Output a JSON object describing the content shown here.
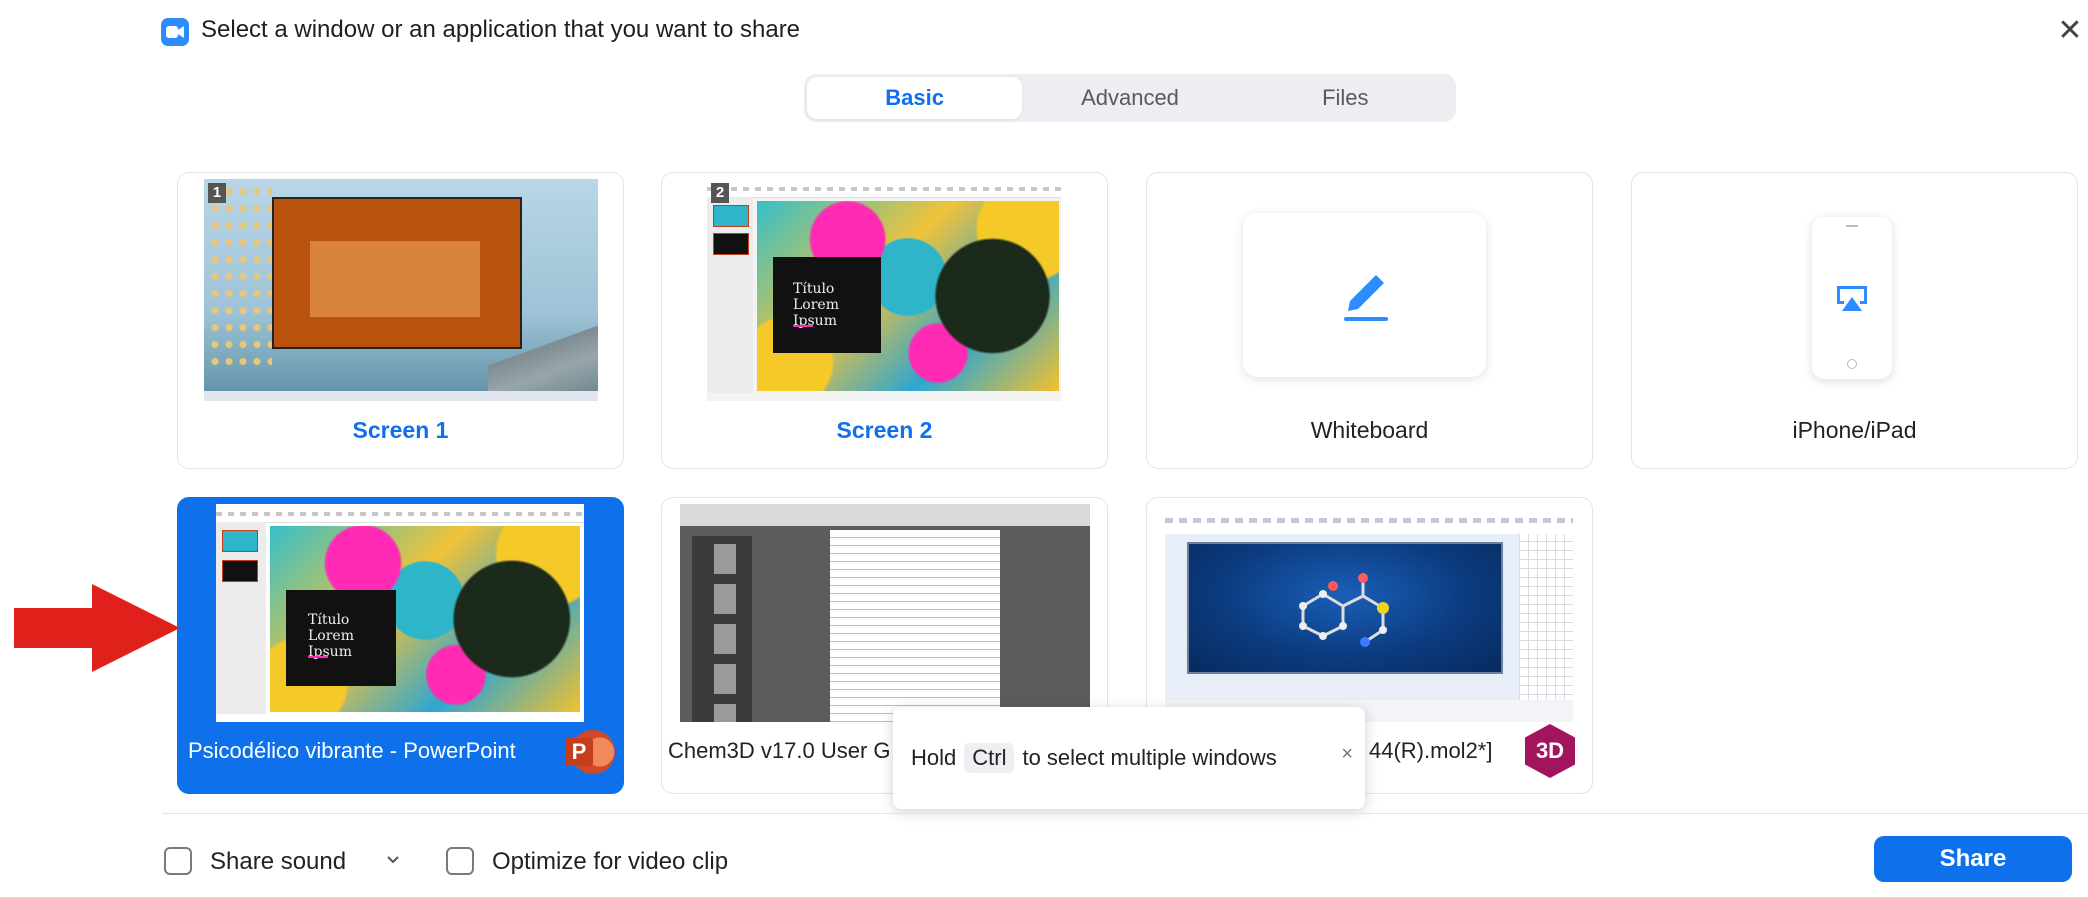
{
  "header": {
    "title": "Select a window or an application that you want to share",
    "close_icon": "close-icon"
  },
  "tabs": [
    {
      "label": "Basic",
      "active": true
    },
    {
      "label": "Advanced",
      "active": false
    },
    {
      "label": "Files",
      "active": false
    }
  ],
  "cards": {
    "screen1": {
      "label": "Screen 1",
      "badge": "1"
    },
    "screen2": {
      "label": "Screen 2",
      "badge": "2",
      "slide_title": "Título Lorem Ipsum"
    },
    "whiteboard": {
      "label": "Whiteboard",
      "icon": "pencil-icon"
    },
    "iphone": {
      "label": "iPhone/iPad",
      "icon": "airplay-icon"
    },
    "powerpoint": {
      "label": "Psicodélico vibrante - PowerPoint",
      "badge_letter": "P",
      "slide_title": "Título Lorem Ipsum",
      "selected": true
    },
    "chem_doc": {
      "label": "Chem3D v17.0 User G"
    },
    "chem_mol": {
      "label": "44(R).mol2*]",
      "badge_text": "3D"
    }
  },
  "tooltip": {
    "before": "Hold",
    "key": "Ctrl",
    "after": "to select multiple windows",
    "close": "×"
  },
  "footer": {
    "share_sound_label": "Share sound",
    "optimize_label": "Optimize for video clip",
    "share_button": "Share"
  },
  "colors": {
    "accent": "#0E71EB",
    "annotation_arrow": "#E0201B"
  }
}
